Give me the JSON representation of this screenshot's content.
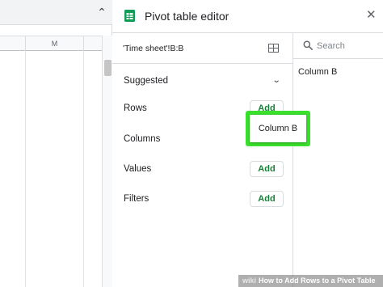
{
  "sheet": {
    "column_header": "M",
    "collapse_icon": "chevron-up-icon"
  },
  "editor": {
    "title": "Pivot table editor",
    "icon": "sheets-icon",
    "close_icon": "close-icon"
  },
  "range": {
    "value": "'Time sheet'!B:B",
    "icon": "grid-select-icon"
  },
  "sections": {
    "suggested": "Suggested",
    "rows": "Rows",
    "columns": "Columns",
    "values": "Values",
    "filters": "Filters"
  },
  "buttons": {
    "rows_add": "Add",
    "values_add": "Add",
    "filters_add": "Add"
  },
  "dropdown": {
    "item": "Column B",
    "highlight_color": "#3ae02d"
  },
  "fields": {
    "search_placeholder": "Search",
    "items": [
      "Column B"
    ]
  },
  "colors": {
    "accent_green": "#188038",
    "sheets_green": "#0f9d58"
  },
  "watermark": {
    "brand": "wiki",
    "text": "How to Add Rows to a Pivot Table"
  }
}
